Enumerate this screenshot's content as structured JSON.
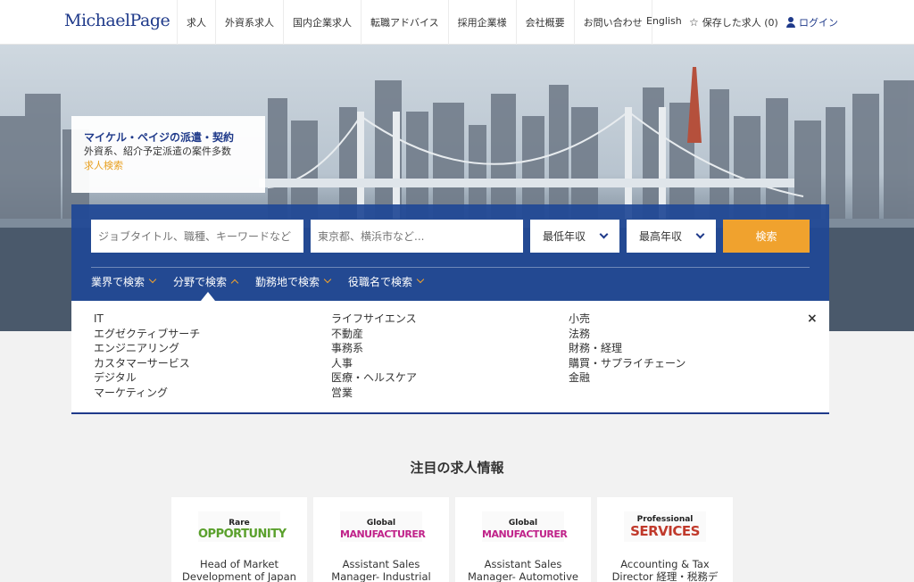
{
  "header": {
    "logo": "MichaelPage",
    "nav": [
      "求人",
      "外資系求人",
      "国内企業求人",
      "転職アドバイス",
      "採用企業様",
      "会社概要",
      "お問い合わせ"
    ],
    "english": "English",
    "saved": "保存した求人 (0)",
    "login": "ログイン"
  },
  "promo": {
    "title": "マイケル・ペイジの派遣・契約",
    "subtitle": "外資系、紹介予定派遣の案件多数",
    "link": "求人検索"
  },
  "search": {
    "keyword_placeholder": "ジョブタイトル、職種、キーワードなど",
    "location_placeholder": "東京都、横浜市など...",
    "min_salary": "最低年収",
    "max_salary": "最高年収",
    "button": "検索"
  },
  "filter_tabs": [
    "業界で検索",
    "分野で検索",
    "勤務地で検索",
    "役職名で検索"
  ],
  "dropdown": {
    "col1": [
      "IT",
      "エグゼクティブサーチ",
      "エンジニアリング",
      "カスタマーサービス",
      "デジタル",
      "マーケティング"
    ],
    "col2": [
      "ライフサイエンス",
      "不動産",
      "事務系",
      "人事",
      "医療・ヘルスケア",
      "営業"
    ],
    "col3": [
      "小売",
      "法務",
      "財務・経理",
      "購買・サプライチェーン",
      "金融"
    ],
    "close": "×"
  },
  "featured": {
    "title": "注目の求人情報",
    "jobs": [
      {
        "badge_top": "Rare",
        "badge_main": "OPPORTUNITY",
        "title": "Head of Market Development of Japan"
      },
      {
        "badge_top": "Global",
        "badge_main": "MANUFACTURER",
        "title": "Assistant Sales Manager- Industrial"
      },
      {
        "badge_top": "Global",
        "badge_main": "MANUFACTURER",
        "title": "Assistant Sales Manager- Automotive"
      },
      {
        "badge_top": "Professional",
        "badge_main": "SERVICES",
        "title": "Accounting & Tax Director 経理・税務デ"
      }
    ]
  },
  "colors": {
    "brand_navy": "#1f3a8a",
    "search_orange": "#f0a22e",
    "panel_blue": "#204896"
  }
}
